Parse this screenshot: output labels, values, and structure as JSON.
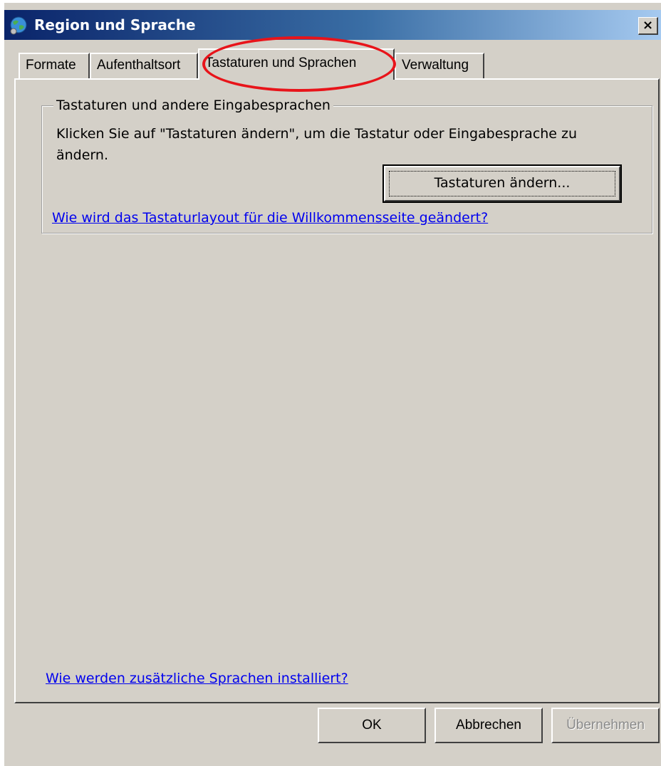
{
  "window": {
    "title": "Region und Sprache",
    "close_label": "×"
  },
  "tabs": [
    {
      "label": "Formate"
    },
    {
      "label": "Aufenthaltsort"
    },
    {
      "label": "Tastaturen und Sprachen",
      "active": true
    },
    {
      "label": "Verwaltung"
    }
  ],
  "group": {
    "legend": "Tastaturen und andere Eingabesprachen",
    "description": "Klicken Sie auf \"Tastaturen ändern\", um die Tastatur oder Eingabesprache zu ändern.",
    "change_button": "Tastaturen ändern...",
    "welcome_link": "Wie wird das Tastaturlayout für die Willkommensseite geändert?"
  },
  "install_link": "Wie werden zusätzliche Sprachen installiert?",
  "buttons": {
    "ok": "OK",
    "cancel": "Abbrechen",
    "apply": "Übernehmen",
    "apply_enabled": false
  },
  "annotation": {
    "highlight_color": "#e8141a",
    "highlighted_tab": "Tastaturen und Sprachen"
  },
  "colors": {
    "dialog_bg": "#d4d0c8",
    "titlebar_start": "#0a246a",
    "titlebar_end": "#a6caf0",
    "link": "#0000ee"
  }
}
